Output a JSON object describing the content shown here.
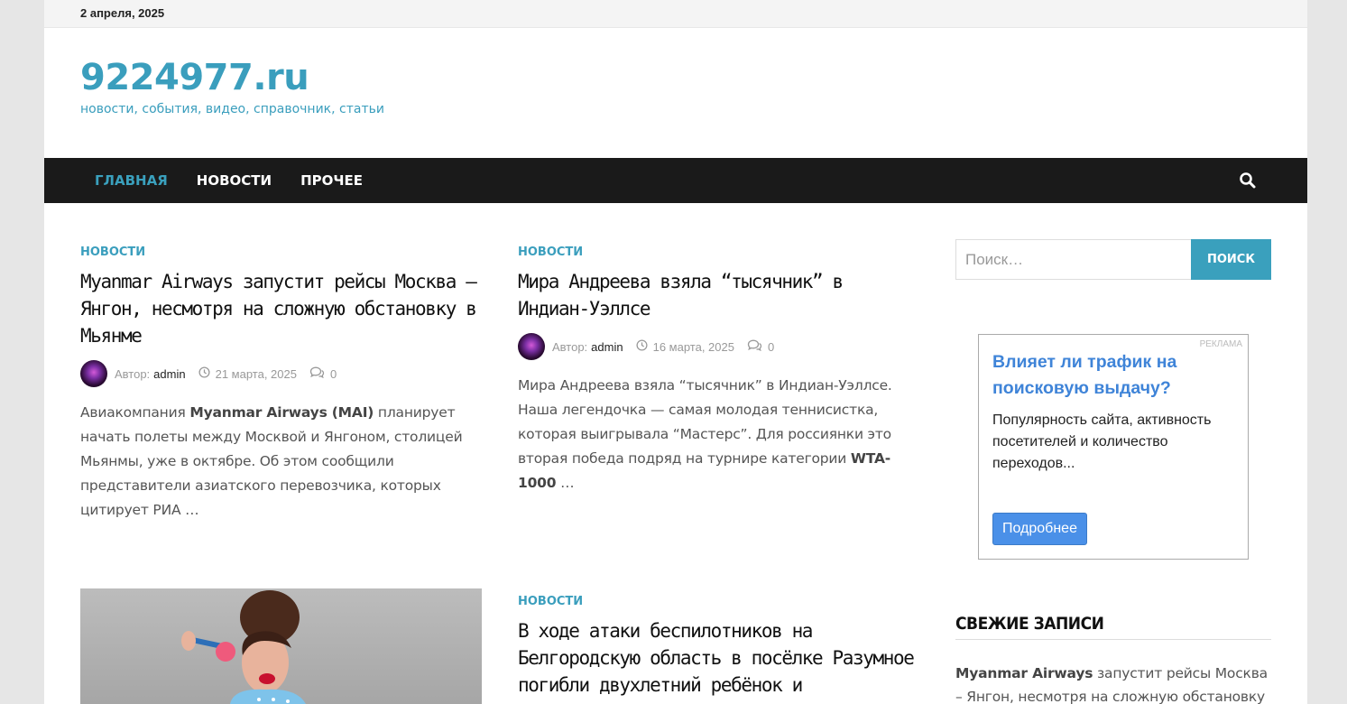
{
  "topbar": {
    "date": "2 апреля, 2025"
  },
  "site": {
    "title": "9224977.ru",
    "description": "новости, события, видео, справочник, статьи"
  },
  "nav": {
    "items": [
      {
        "label": "ГЛАВНАЯ"
      },
      {
        "label": "НОВОСТИ"
      },
      {
        "label": "ПРОЧЕЕ"
      }
    ]
  },
  "posts": [
    {
      "category": "НОВОСТИ",
      "title": "Myanmar Airways запустит рейсы Москва – Янгон, несмотря на сложную обстановку в Мьянме",
      "author_label": "Автор:",
      "author": "admin",
      "date": "21 марта, 2025",
      "comments": "0",
      "excerpt_pre": "Авиакомпания ",
      "excerpt_bold": "Myanmar Airways (MAI)",
      "excerpt_post": " планирует начать полеты между Москвой и Янгоном, столицей Мьянмы, уже в октябре. Об этом сообщили представители азиатского перевозчика, которых цитирует РИА …"
    },
    {
      "category": "НОВОСТИ",
      "title": "Мира Андреева взяла “тысячник” в Индиан-Уэллсе",
      "author_label": "Автор:",
      "author": "admin",
      "date": "16 марта, 2025",
      "comments": "0",
      "excerpt_pre": "Мира Андреева взяла “тысячник” в Индиан-Уэллсе. Наша легендочка — самая молодая теннисистка, которая выигрывала “Мастерс”. Для россиянки это вторая победа подряд на турнире категории ",
      "excerpt_bold": "WTA-1000",
      "excerpt_post": " …"
    },
    {
      "category": "НОВОСТИ",
      "title": "В ходе атаки беспилотников на Белгородскую область в посёлке Разумное погибли двухлетний ребёнок и"
    }
  ],
  "sidebar": {
    "search": {
      "placeholder": "Поиск…",
      "button": "ПОИСК"
    },
    "ad": {
      "tag": "РЕКЛАМА",
      "title": "Влияет ли трафик на поисковую выдачу?",
      "text": "Популярность сайта, активность посетителей и количество переходов...",
      "button": "Подробнее"
    },
    "recent": {
      "title": "СВЕЖИЕ ЗАПИСИ",
      "item_bold": "Myanmar Airways",
      "item_rest": " запустит рейсы Москва – Янгон, несмотря на сложную обстановку в"
    }
  },
  "colors": {
    "accent": "#3a9ebd",
    "nav_bg": "#1a1a1a",
    "ad_link": "#3f84d8",
    "ad_button": "#4a90e8"
  }
}
